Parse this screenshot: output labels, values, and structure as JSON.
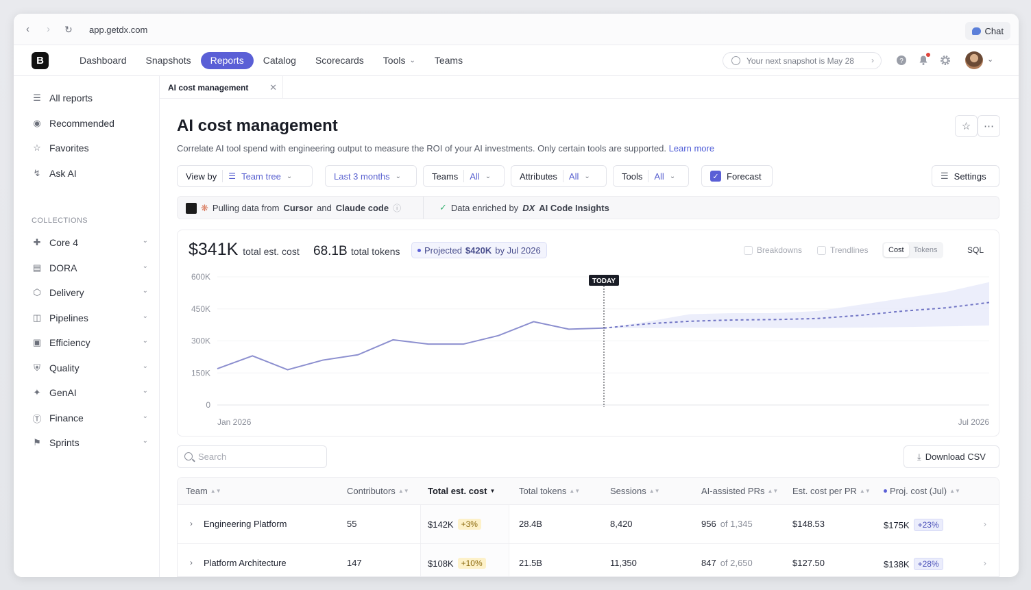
{
  "browser": {
    "url": "app.getdx.com",
    "chat_label": "Chat"
  },
  "nav": {
    "logo": "B",
    "items": [
      {
        "label": "Dashboard"
      },
      {
        "label": "Snapshots"
      },
      {
        "label": "Reports",
        "active": true
      },
      {
        "label": "Catalog"
      },
      {
        "label": "Scorecards"
      },
      {
        "label": "Tools",
        "dropdown": true
      },
      {
        "label": "Teams"
      }
    ],
    "snapshot_text": "Your next snapshot is May 28"
  },
  "sidebar": {
    "items": [
      {
        "label": "All reports",
        "icon": "layers-icon"
      },
      {
        "label": "Recommended",
        "icon": "recommended-icon"
      },
      {
        "label": "Favorites",
        "icon": "star-icon"
      },
      {
        "label": "Ask AI",
        "icon": "bolt-icon"
      }
    ],
    "collections_label": "COLLECTIONS",
    "collections": [
      {
        "label": "Core 4",
        "icon": "core4-icon"
      },
      {
        "label": "DORA",
        "icon": "dora-icon"
      },
      {
        "label": "Delivery",
        "icon": "box-icon"
      },
      {
        "label": "Pipelines",
        "icon": "cylinder-icon"
      },
      {
        "label": "Efficiency",
        "icon": "efficiency-icon"
      },
      {
        "label": "Quality",
        "icon": "shield-icon"
      },
      {
        "label": "GenAI",
        "icon": "genai-icon"
      },
      {
        "label": "Finance",
        "icon": "dollar-icon"
      },
      {
        "label": "Sprints",
        "icon": "flag-icon"
      }
    ]
  },
  "tab": {
    "label": "AI cost management"
  },
  "page": {
    "title": "AI cost management",
    "subtitle": "Correlate AI tool spend with engineering output to measure the ROI of your AI investments. Only certain tools are supported.",
    "learn_more": "Learn more"
  },
  "filters": {
    "view_by_label": "View by",
    "view_by_value": "Team tree",
    "period": "Last 3 months",
    "teams_label": "Teams",
    "teams_value": "All",
    "attributes_label": "Attributes",
    "attributes_value": "All",
    "tools_label": "Tools",
    "tools_value": "All",
    "forecast_label": "Forecast",
    "settings_label": "Settings"
  },
  "info": {
    "pulling_prefix": "Pulling data from",
    "source1": "Cursor",
    "and": "and",
    "source2": "Claude code",
    "enriched_prefix": "Data enriched by",
    "dx_logo": "DX",
    "enriched_product": "AI Code Insights"
  },
  "summary": {
    "total_cost": "$341K",
    "total_cost_label": "total est. cost",
    "total_tokens": "68.1B",
    "total_tokens_label": "total tokens",
    "projected_prefix": "Projected",
    "projected_value": "$420K",
    "projected_suffix": "by Jul 2026"
  },
  "chart_controls": {
    "breakdowns": "Breakdowns",
    "trendlines": "Trendlines",
    "cost": "Cost",
    "tokens": "Tokens",
    "sql": "SQL"
  },
  "chart_data": {
    "type": "line",
    "yticks": [
      "600K",
      "450K",
      "300K",
      "150K",
      "0"
    ],
    "ylim": [
      0,
      600000
    ],
    "x_start_label": "Jan 2026",
    "x_end_label": "Jul 2026",
    "today_label": "TODAY",
    "actual": [
      170000,
      230000,
      165000,
      210000,
      235000,
      305000,
      285000,
      285000,
      325000,
      390000,
      355000,
      360000
    ],
    "forecast": [
      360000,
      380000,
      392000,
      398000,
      400000,
      405000,
      420000,
      440000,
      455000,
      480000
    ],
    "forecast_upper": [
      360000,
      390000,
      425000,
      430000,
      430000,
      440000,
      470000,
      500000,
      530000,
      575000
    ],
    "forecast_lower": [
      360000,
      360000,
      362000,
      362000,
      360000,
      360000,
      362000,
      365000,
      368000,
      372000
    ],
    "colors": {
      "line": "#8c8fcf",
      "forecast": "#6f73c4",
      "band": "#e9ebfa"
    }
  },
  "table": {
    "search_placeholder": "Search",
    "download_label": "Download CSV",
    "columns": [
      "Team",
      "Contributors",
      "Total est. cost",
      "Total tokens",
      "Sessions",
      "AI-assisted PRs",
      "Est. cost per PR",
      "Proj. cost (Jul)"
    ],
    "rows": [
      {
        "team": "Engineering Platform",
        "contributors": "55",
        "cost": "$142K",
        "cost_change": "+3%",
        "tokens": "28.4B",
        "sessions": "8,420",
        "prs": "956",
        "prs_total": "of 1,345",
        "cost_per_pr": "$148.53",
        "proj": "$175K",
        "proj_change": "+23%"
      },
      {
        "team": "Platform Architecture",
        "contributors": "147",
        "cost": "$108K",
        "cost_change": "+10%",
        "tokens": "21.5B",
        "sessions": "11,350",
        "prs": "847",
        "prs_total": "of 2,650",
        "cost_per_pr": "$127.50",
        "proj": "$138K",
        "proj_change": "+28%"
      }
    ]
  }
}
